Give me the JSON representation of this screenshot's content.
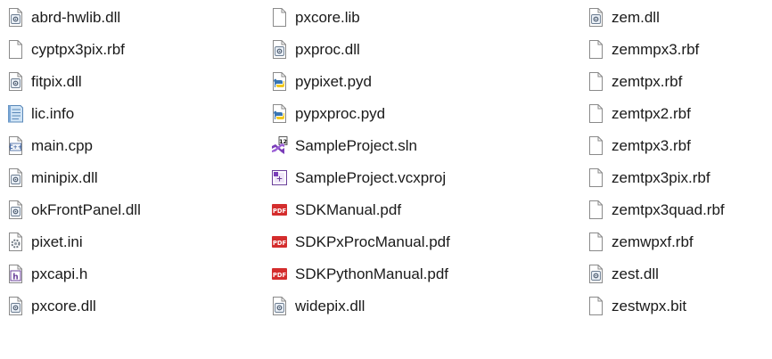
{
  "columns": [
    [
      {
        "name": "abrd-hwlib.dll",
        "icon": "dll-icon"
      },
      {
        "name": "cyptpx3pix.rbf",
        "icon": "blank-file-icon"
      },
      {
        "name": "fitpix.dll",
        "icon": "dll-icon"
      },
      {
        "name": "lic.info",
        "icon": "text-file-icon"
      },
      {
        "name": "main.cpp",
        "icon": "cpp-file-icon"
      },
      {
        "name": "minipix.dll",
        "icon": "dll-icon"
      },
      {
        "name": "okFrontPanel.dll",
        "icon": "dll-icon"
      },
      {
        "name": "pixet.ini",
        "icon": "ini-settings-icon"
      },
      {
        "name": "pxcapi.h",
        "icon": "header-file-icon"
      },
      {
        "name": "pxcore.dll",
        "icon": "dll-icon"
      }
    ],
    [
      {
        "name": "pxcore.lib",
        "icon": "blank-file-icon"
      },
      {
        "name": "pxproc.dll",
        "icon": "dll-icon"
      },
      {
        "name": "pypixet.pyd",
        "icon": "python-file-icon"
      },
      {
        "name": "pypxproc.pyd",
        "icon": "python-file-icon"
      },
      {
        "name": "SampleProject.sln",
        "icon": "visual-studio-solution-icon"
      },
      {
        "name": "SampleProject.vcxproj",
        "icon": "vcxproj-icon"
      },
      {
        "name": "SDKManual.pdf",
        "icon": "pdf-icon"
      },
      {
        "name": "SDKPxProcManual.pdf",
        "icon": "pdf-icon"
      },
      {
        "name": "SDKPythonManual.pdf",
        "icon": "pdf-icon"
      },
      {
        "name": "widepix.dll",
        "icon": "dll-icon"
      }
    ],
    [
      {
        "name": "zem.dll",
        "icon": "dll-icon"
      },
      {
        "name": "zemmpx3.rbf",
        "icon": "blank-file-icon"
      },
      {
        "name": "zemtpx.rbf",
        "icon": "blank-file-icon"
      },
      {
        "name": "zemtpx2.rbf",
        "icon": "blank-file-icon"
      },
      {
        "name": "zemtpx3.rbf",
        "icon": "blank-file-icon"
      },
      {
        "name": "zemtpx3pix.rbf",
        "icon": "blank-file-icon"
      },
      {
        "name": "zemtpx3quad.rbf",
        "icon": "blank-file-icon"
      },
      {
        "name": "zemwpxf.rbf",
        "icon": "blank-file-icon"
      },
      {
        "name": "zest.dll",
        "icon": "dll-icon"
      },
      {
        "name": "zestwpx.bit",
        "icon": "blank-file-icon"
      }
    ]
  ],
  "colors": {
    "text": "#1a1a1a",
    "file_outline": "#8a8a8a",
    "pdf_red": "#d42d2d",
    "python_blue": "#3a76b3",
    "python_yellow": "#f2c81e",
    "vs_purple": "#7a3db8"
  }
}
